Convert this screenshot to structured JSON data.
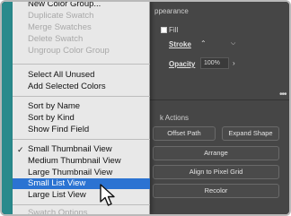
{
  "panel": {
    "title": "ppearance",
    "fill_label": "Fill",
    "stroke_label": "Stroke",
    "stroke_spinner": "⌃",
    "stroke_dropdown": "⌵",
    "opacity_label": "Opacity",
    "opacity_value": "100%",
    "opacity_arrow": "›",
    "more_icon": "•••",
    "quick_actions_label": "k Actions",
    "buttons": {
      "offset_path": "Offset Path",
      "expand_shape": "Expand Shape",
      "arrange": "Arrange",
      "align_pixel_grid": "Align to Pixel Grid",
      "recolor": "Recolor"
    }
  },
  "menu": {
    "items": [
      {
        "label": "New Color Group...",
        "disabled": false
      },
      {
        "label": "Duplicate Swatch",
        "disabled": true
      },
      {
        "label": "Merge Swatches",
        "disabled": true
      },
      {
        "label": "Delete Swatch",
        "disabled": true
      },
      {
        "label": "Ungroup Color Group",
        "disabled": true
      },
      {
        "label": "Select All Unused",
        "disabled": false
      },
      {
        "label": "Add Selected Colors",
        "disabled": false
      },
      {
        "label": "Sort by Name",
        "disabled": false
      },
      {
        "label": "Sort by Kind",
        "disabled": false
      },
      {
        "label": "Show Find Field",
        "disabled": false
      },
      {
        "label": "Small Thumbnail View",
        "disabled": false,
        "checked": true
      },
      {
        "label": "Medium Thumbnail View",
        "disabled": false
      },
      {
        "label": "Large Thumbnail View",
        "disabled": false
      },
      {
        "label": "Small List View",
        "disabled": false,
        "selected": true
      },
      {
        "label": "Large List View",
        "disabled": false
      },
      {
        "label": "Swatch Options...",
        "disabled": true
      }
    ],
    "checkmark": "✓"
  },
  "colors": {
    "highlight": "#2b73d2",
    "menu_bg": "#e8e8e8",
    "panel_bg": "#464646",
    "accent_strip": "#2a8a8c"
  }
}
